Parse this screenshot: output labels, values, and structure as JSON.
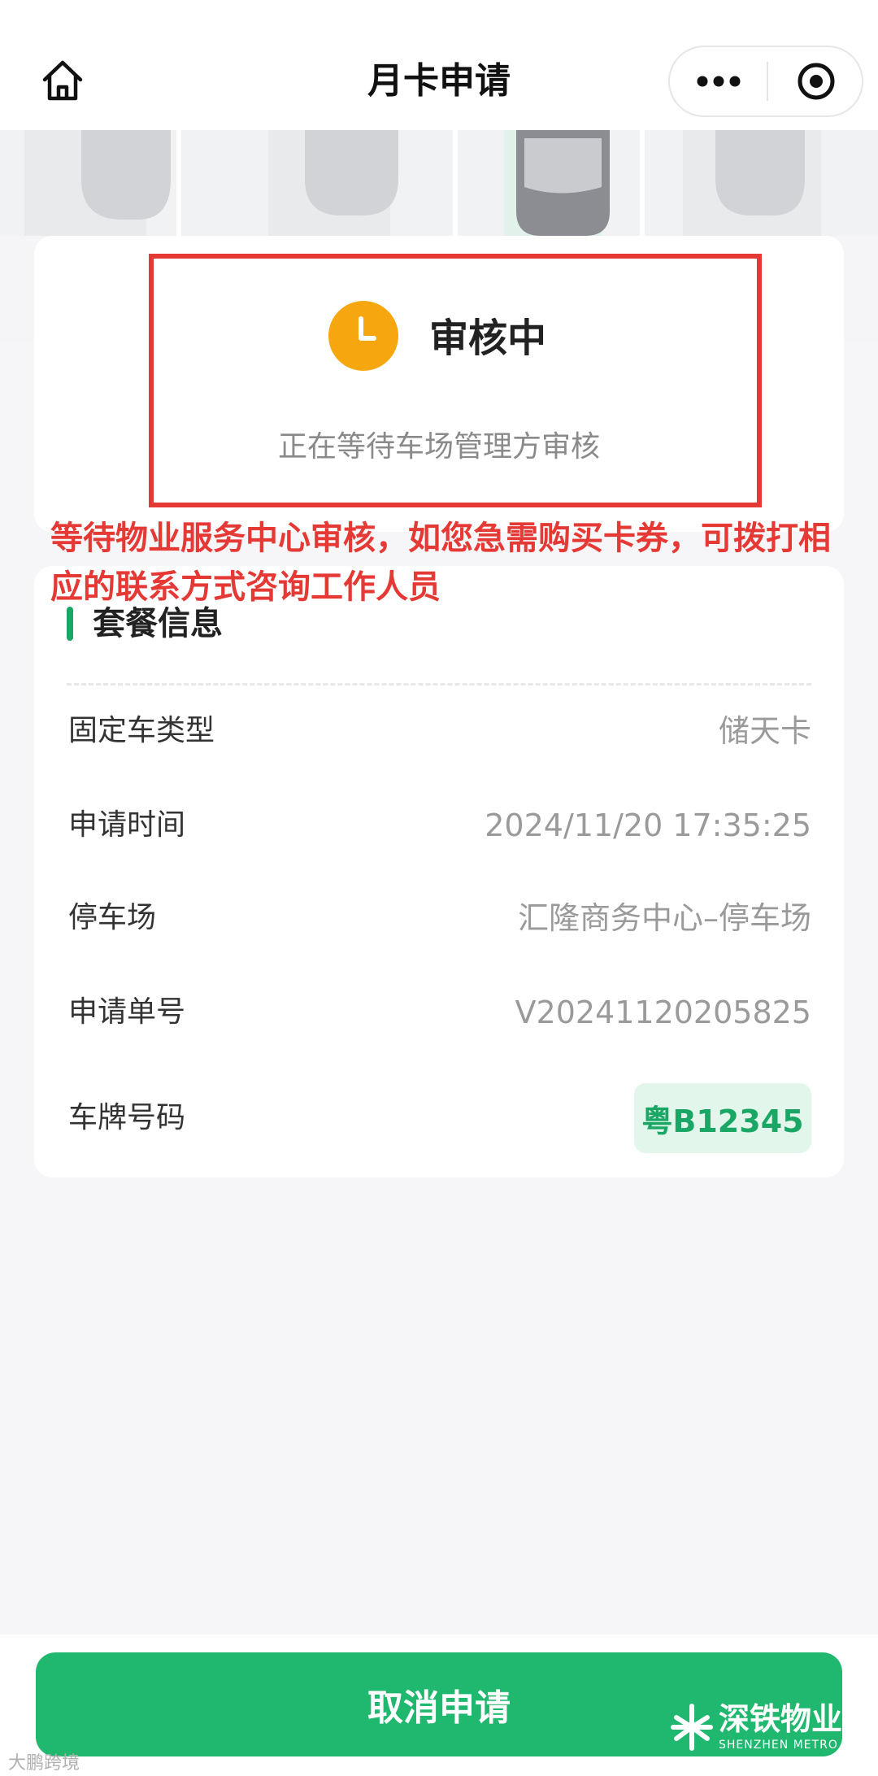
{
  "header": {
    "title": "月卡申请",
    "home_icon": "home-icon",
    "more_icon": "more-dots-icon",
    "close_icon": "target-circle-icon"
  },
  "status": {
    "icon": "clock-icon",
    "title": "审核中",
    "subtitle": "正在等待车场管理方审核"
  },
  "annotation": {
    "text": "等待物业服务中心审核，如您急需购买卡券，可拨打相应的联系方式咨询工作人员"
  },
  "package_info": {
    "section_title": "套餐信息",
    "rows": [
      {
        "label": "固定车类型",
        "value": "储天卡"
      },
      {
        "label": "申请时间",
        "value": "2024/11/20 17:35:25"
      },
      {
        "label": "停车场",
        "value": "汇隆商务中心–停车场"
      },
      {
        "label": "申请单号",
        "value": "V20241120205825"
      },
      {
        "label": "车牌号码",
        "value": "粤B12345"
      }
    ]
  },
  "actions": {
    "cancel_label": "取消申请"
  },
  "watermark": {
    "brand": "深铁物业",
    "brand_en": "SHENZHEN METRO",
    "corner": "大鹏跨境"
  },
  "colors": {
    "accent_green": "#1fb86e",
    "status_orange": "#f6a70f",
    "annotation_red": "#e53935"
  }
}
